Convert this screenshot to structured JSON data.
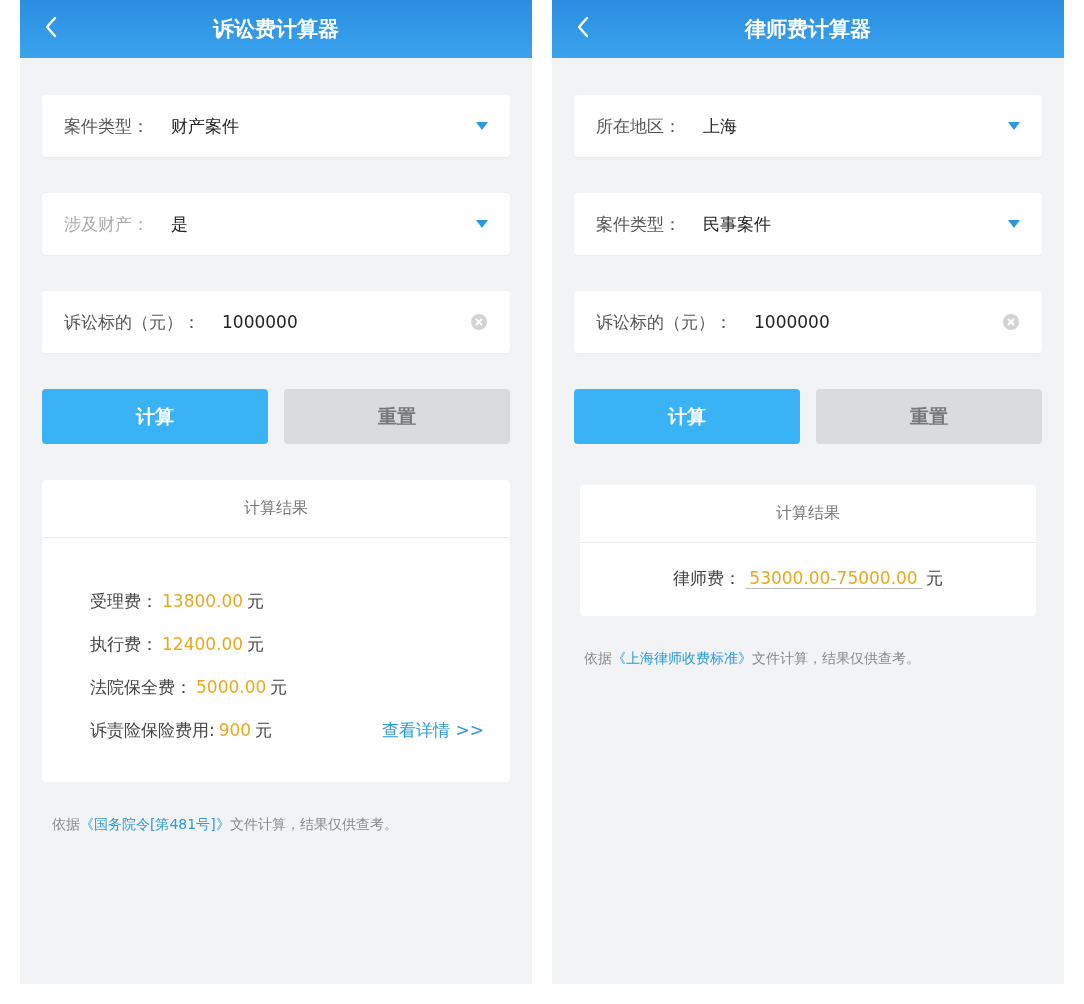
{
  "screens": [
    {
      "title": "诉讼费计算器",
      "fields": [
        {
          "kind": "select",
          "label": "案件类型：",
          "value": "财产案件",
          "dim": false
        },
        {
          "kind": "select",
          "label": "涉及财产：",
          "value": "是",
          "dim": true
        },
        {
          "kind": "input",
          "label": "诉讼标的（元）：",
          "value": "1000000",
          "dim": false
        }
      ],
      "buttons": [
        {
          "kind": "primary",
          "label": "计算"
        },
        {
          "kind": "secondary",
          "label": "重置"
        }
      ],
      "result": {
        "title": "计算结果",
        "kind": "list",
        "lines": [
          {
            "label": "受理费：",
            "amount": "13800.00",
            "unit": "元",
            "underlined": false
          },
          {
            "label": "执行费：",
            "amount": "12400.00",
            "unit": "元",
            "underlined": false
          },
          {
            "label": "法院保全费：",
            "amount": "5000.00",
            "unit": "元",
            "underlined": false
          },
          {
            "label": "诉责险保险费用:",
            "amount": "900",
            "unit": "元",
            "underlined": false,
            "link": "查看详情 >>"
          }
        ]
      },
      "note": {
        "before": "依据",
        "link": "《国务院令[第481号]》",
        "after": "文件计算，结果仅供查考。"
      }
    },
    {
      "title": "律师费计算器",
      "fields": [
        {
          "kind": "select",
          "label": "所在地区：",
          "value": "上海",
          "dim": false
        },
        {
          "kind": "select",
          "label": "案件类型：",
          "value": "民事案件",
          "dim": false
        },
        {
          "kind": "input",
          "label": "诉讼标的（元）：",
          "value": "1000000",
          "dim": false
        }
      ],
      "buttons": [
        {
          "kind": "primary",
          "label": "计算"
        },
        {
          "kind": "secondary",
          "label": "重置"
        }
      ],
      "result": {
        "title": "计算结果",
        "kind": "centered",
        "lines": [
          {
            "label": "律师费：",
            "amount": "53000.00-75000.00",
            "unit": "元",
            "underlined": true
          }
        ]
      },
      "note": {
        "before": "依据",
        "link": "《上海律师收费标准》",
        "after": "文件计算，结果仅供查考。"
      }
    }
  ]
}
